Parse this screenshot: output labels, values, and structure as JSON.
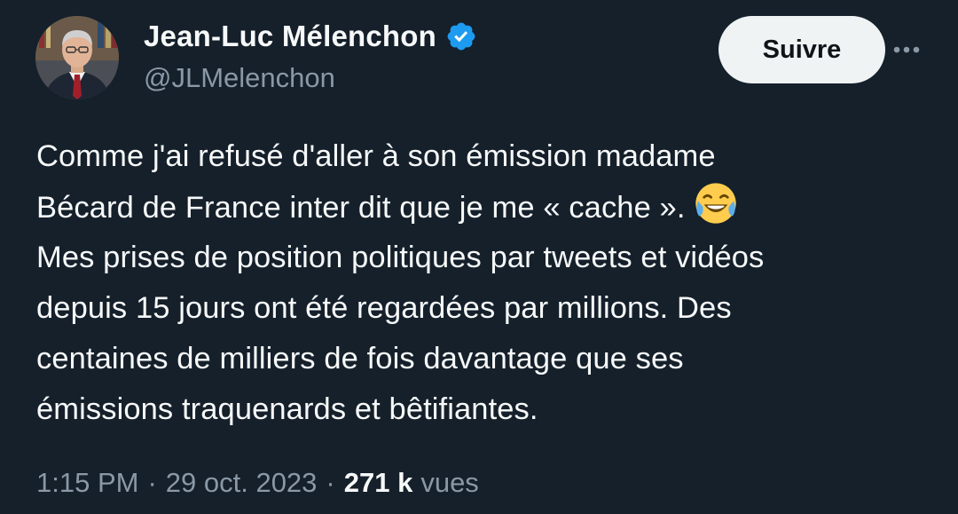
{
  "author": {
    "display_name": "Jean-Luc Mélenchon",
    "handle": "@JLMelenchon",
    "verified": true,
    "verified_badge_color": "#1d9bf0",
    "avatar": "profile-photo"
  },
  "actions": {
    "follow_label": "Suivre",
    "more_icon": "more-horizontal-icon"
  },
  "tweet": {
    "lines": [
      "Comme j'ai refusé d'aller à son émission madame",
      "Bécard de France inter dit que je me « cache ».",
      "Mes prises de position politiques par tweets et vidéos",
      "depuis 15 jours ont été regardées par millions. Des",
      "centaines de milliers de fois davantage que ses",
      "émissions traquenards et bêtifiantes."
    ],
    "emoji": "face-with-tears-of-joy"
  },
  "meta": {
    "time": "1:15 PM",
    "separator": "·",
    "date": "29 oct. 2023",
    "views_count": "271 k",
    "views_label": "vues"
  },
  "colors": {
    "background": "#15202b",
    "text_primary": "#f7f9f9",
    "text_secondary": "#8b98a5",
    "button_bg": "#eff3f4",
    "button_text": "#0f1419"
  }
}
